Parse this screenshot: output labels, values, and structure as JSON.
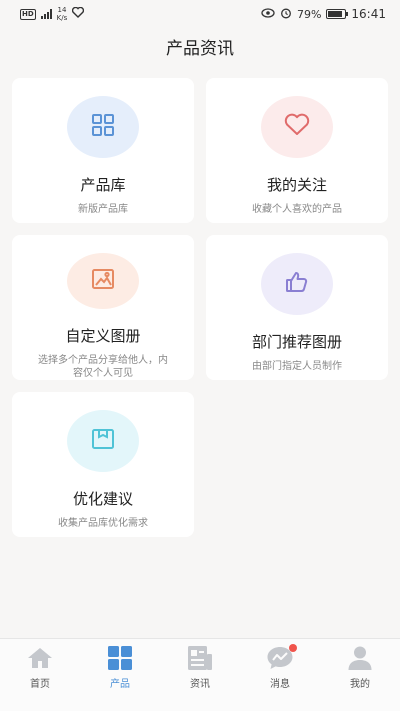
{
  "status_bar": {
    "hd": "HD",
    "net_speed_value": "14",
    "net_speed_unit": "K/s",
    "battery": "79%",
    "time": "16:41"
  },
  "header": {
    "title": "产品资讯"
  },
  "cards": [
    {
      "title": "产品库",
      "desc": "新版产品库",
      "icon": "grid-icon",
      "circle_color": "#e5eefb",
      "icon_color": "#5b93d6"
    },
    {
      "title": "我的关注",
      "desc": "收藏个人喜欢的产品",
      "icon": "heart-icon",
      "circle_color": "#fcebeb",
      "icon_color": "#e06b6b"
    },
    {
      "title": "自定义图册",
      "desc": "选择多个产品分享给他人，内容仅个人可见",
      "icon": "image-icon",
      "circle_color": "#fdece4",
      "icon_color": "#e68a62"
    },
    {
      "title": "部门推荐图册",
      "desc": "由部门指定人员制作",
      "icon": "thumbs-up-icon",
      "circle_color": "#eeecfa",
      "icon_color": "#8a7fd2"
    },
    {
      "title": "优化建议",
      "desc": "收集产品库优化需求",
      "icon": "box-icon",
      "circle_color": "#e3f6fa",
      "icon_color": "#4fc3d6"
    }
  ],
  "nav": {
    "items": [
      {
        "label": "首页",
        "icon": "home-icon",
        "active": false
      },
      {
        "label": "产品",
        "icon": "apps-icon",
        "active": true
      },
      {
        "label": "资讯",
        "icon": "news-icon",
        "active": false
      },
      {
        "label": "消息",
        "icon": "message-icon",
        "active": false
      },
      {
        "label": "我的",
        "icon": "user-icon",
        "active": false
      }
    ],
    "active_color": "#4a8fd6",
    "inactive_color": "#c4c7cc"
  }
}
